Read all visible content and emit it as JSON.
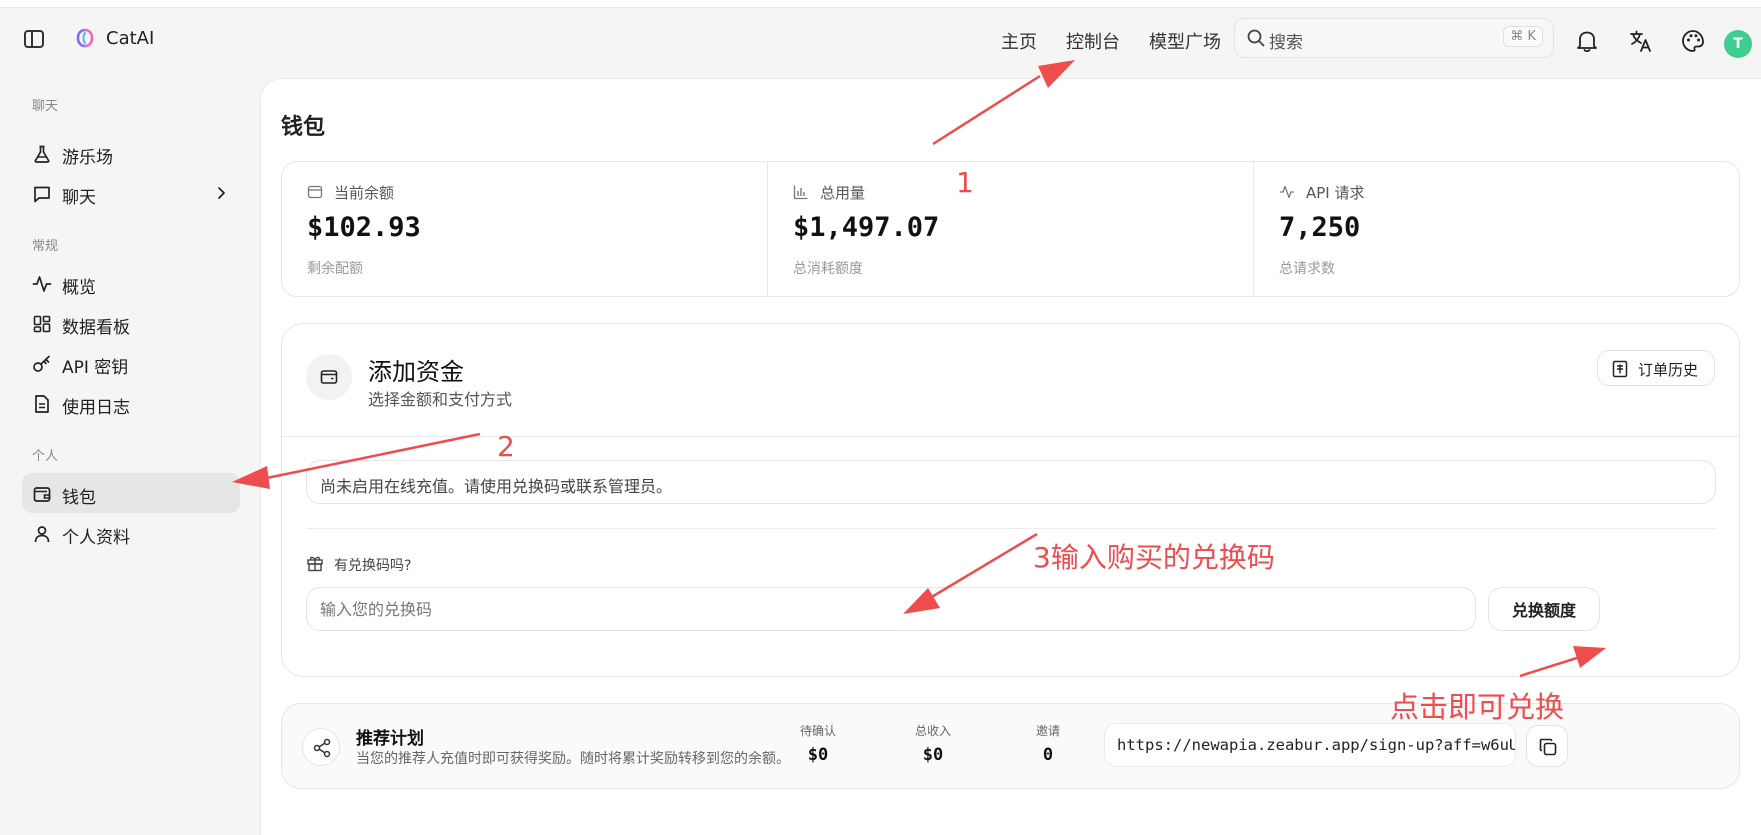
{
  "app": {
    "name": "CatAI"
  },
  "nav": {
    "home": "主页",
    "console": "控制台",
    "models": "模型广场"
  },
  "search": {
    "placeholder": "搜索",
    "shortcut": "⌘ K"
  },
  "user": {
    "avatar_letter": "T",
    "avatar_color": "#3ecf8e"
  },
  "sidebar": {
    "sections": {
      "chat": "聊天",
      "general": "常规",
      "personal": "个人"
    },
    "items": {
      "playground": "游乐场",
      "chat": "聊天",
      "overview": "概览",
      "dashboard": "数据看板",
      "api_keys": "API 密钥",
      "usage_logs": "使用日志",
      "wallet": "钱包",
      "profile": "个人资料"
    },
    "active": "wallet"
  },
  "page": {
    "title": "钱包"
  },
  "stats": [
    {
      "icon": "wallet-icon",
      "label": "当前余额",
      "value": "$102.93",
      "sub": "剩余配额"
    },
    {
      "icon": "bar-chart-icon",
      "label": "总用量",
      "value": "$1,497.07",
      "sub": "总消耗额度"
    },
    {
      "icon": "activity-icon",
      "label": "API 请求",
      "value": "7,250",
      "sub": "总请求数"
    }
  ],
  "funds": {
    "title": "添加资金",
    "subtitle": "选择金额和支付方式",
    "order_history": "订单历史",
    "notice": "尚未启用在线充值。请使用兑换码或联系管理员。",
    "redeem_question": "有兑换码吗?",
    "code_placeholder": "输入您的兑换码",
    "redeem_button": "兑换额度"
  },
  "referral": {
    "title": "推荐计划",
    "desc": "当您的推荐人充值时即可获得奖励。随时将累计奖励转移到您的余额。",
    "pending_label": "待确认",
    "pending_value": "$0",
    "income_label": "总收入",
    "income_value": "$0",
    "invites_label": "邀请",
    "invites_value": "0",
    "link": "https://newapia.zeabur.app/sign-up?aff=w6uU"
  },
  "annotations": {
    "a1": "1",
    "a2": "2",
    "a3": "3输入购买的兑换码",
    "a4": "点击即可兑换",
    "color": "#ee4d4d"
  }
}
